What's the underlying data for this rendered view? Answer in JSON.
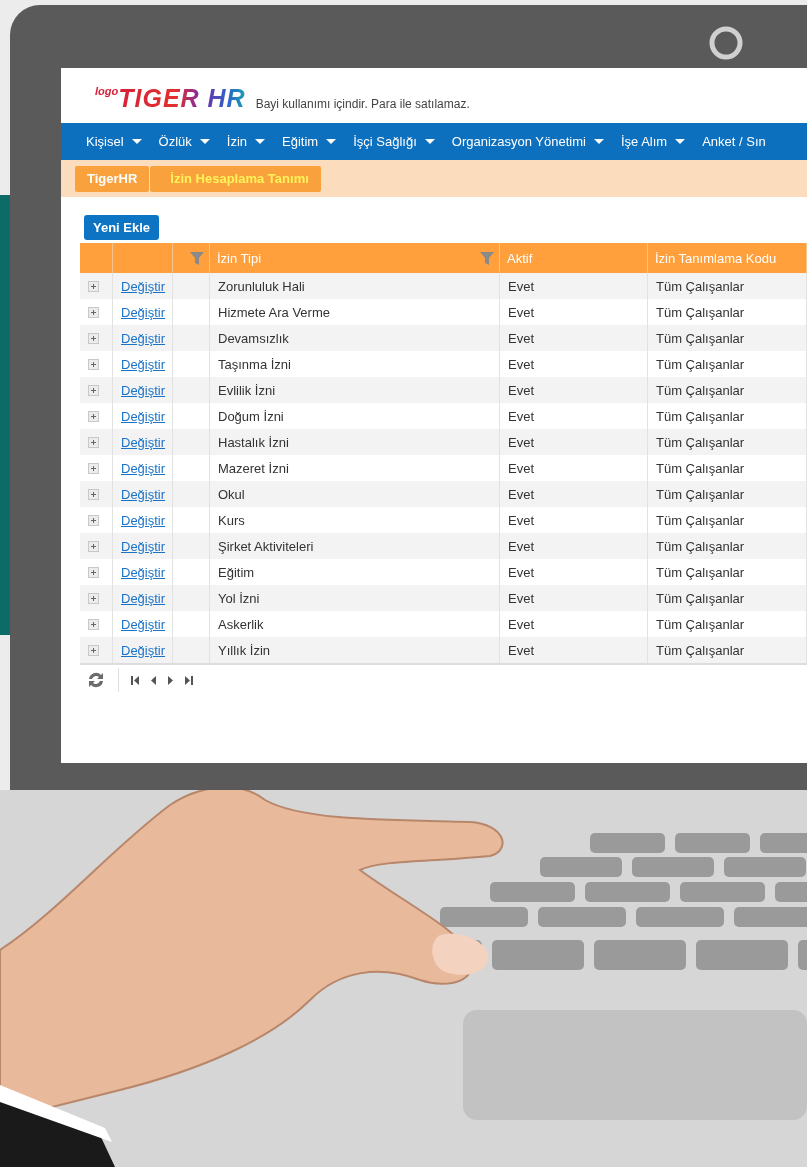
{
  "brand": {
    "logo_small": "logo",
    "logo_text": "TIGER HR",
    "tagline": "Bayi kullanımı içindir. Para ile satılamaz."
  },
  "nav": [
    {
      "label": "Kişisel"
    },
    {
      "label": "Özlük"
    },
    {
      "label": "İzin"
    },
    {
      "label": "Eğitim"
    },
    {
      "label": "İşçi Sağlığı"
    },
    {
      "label": "Organizasyon Yönetimi"
    },
    {
      "label": "İşe Alım"
    },
    {
      "label": "Anket / Sın"
    }
  ],
  "breadcrumb": [
    {
      "label": "TigerHR",
      "current": false
    },
    {
      "label": "İzin Hesaplama Tanımı",
      "current": true
    }
  ],
  "toolbar": {
    "button": "Yeni Ekle"
  },
  "table": {
    "columns": [
      "İzin Tipi",
      "Aktif",
      "İzin Tanımlama Kodu"
    ],
    "rows": [
      {
        "action": "Değiştir",
        "type": "Zorunluluk Hali",
        "active": "Evet",
        "code": "Tüm Çalışanlar"
      },
      {
        "action": "Değiştir",
        "type": "Hizmete Ara Verme",
        "active": "Evet",
        "code": "Tüm Çalışanlar"
      },
      {
        "action": "Değiştir",
        "type": "Devamsızlık",
        "active": "Evet",
        "code": "Tüm Çalışanlar"
      },
      {
        "action": "Değiştir",
        "type": "Taşınma İzni",
        "active": "Evet",
        "code": "Tüm Çalışanlar"
      },
      {
        "action": "Değiştir",
        "type": "Evlilik İzni",
        "active": "Evet",
        "code": "Tüm Çalışanlar"
      },
      {
        "action": "Değiştir",
        "type": "Doğum İzni",
        "active": "Evet",
        "code": "Tüm Çalışanlar"
      },
      {
        "action": "Değiştir",
        "type": "Hastalık İzni",
        "active": "Evet",
        "code": "Tüm Çalışanlar"
      },
      {
        "action": "Değiştir",
        "type": "Mazeret İzni",
        "active": "Evet",
        "code": "Tüm Çalışanlar"
      },
      {
        "action": "Değiştir",
        "type": "Okul",
        "active": "Evet",
        "code": "Tüm Çalışanlar"
      },
      {
        "action": "Değiştir",
        "type": "Kurs",
        "active": "Evet",
        "code": "Tüm Çalışanlar"
      },
      {
        "action": "Değiştir",
        "type": "Şirket Aktiviteleri",
        "active": "Evet",
        "code": "Tüm Çalışanlar"
      },
      {
        "action": "Değiştir",
        "type": "Eğitim",
        "active": "Evet",
        "code": "Tüm Çalışanlar"
      },
      {
        "action": "Değiştir",
        "type": "Yol İzni",
        "active": "Evet",
        "code": "Tüm Çalışanlar"
      },
      {
        "action": "Değiştir",
        "type": "Askerlik",
        "active": "Evet",
        "code": "Tüm Çalışanlar"
      },
      {
        "action": "Değiştir",
        "type": "Yıllık İzin",
        "active": "Evet",
        "code": "Tüm Çalışanlar"
      }
    ]
  }
}
